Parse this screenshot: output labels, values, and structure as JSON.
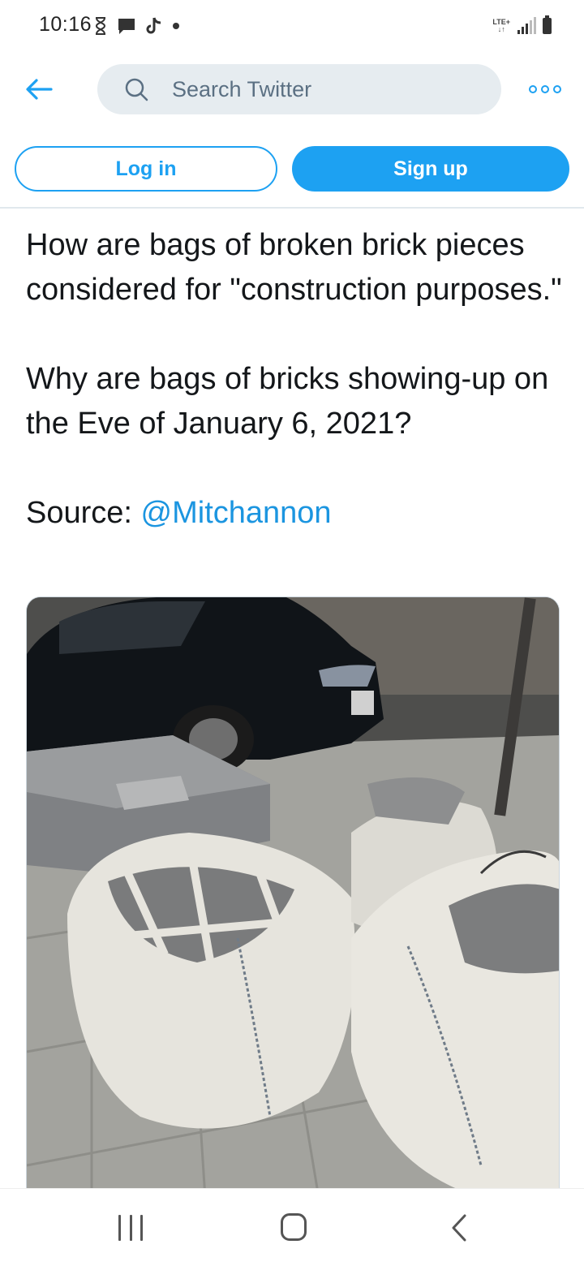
{
  "status_bar": {
    "time": "10:16",
    "left_icons": [
      "hourglass-icon",
      "message-icon",
      "tiktok-icon",
      "notification-dot-icon"
    ],
    "network": "LTE+",
    "right_icons": [
      "signal-icon",
      "battery-icon"
    ]
  },
  "header": {
    "back_icon": "arrow-left-icon",
    "search_placeholder": "Search Twitter",
    "more_icon": "more-options-icon"
  },
  "auth": {
    "login_label": "Log in",
    "signup_label": "Sign up"
  },
  "tweet": {
    "paragraph_1": "How are bags of broken brick pieces considered for \"construction purposes.\"",
    "paragraph_2": "Why are bags of bricks showing-up on the Eve of January 6, 2021?",
    "source_label": "Source: ",
    "source_mention": "@Mitchannon",
    "image_subject": "bulk bags of broken brick pieces on a sidewalk next to a parked black car"
  },
  "nav_bar": {
    "icons": [
      "recents-icon",
      "home-icon",
      "back-icon"
    ]
  },
  "colors": {
    "twitter_blue": "#1da1f2",
    "mention_blue": "#1b95e0",
    "search_bg": "#e6ecf0"
  }
}
